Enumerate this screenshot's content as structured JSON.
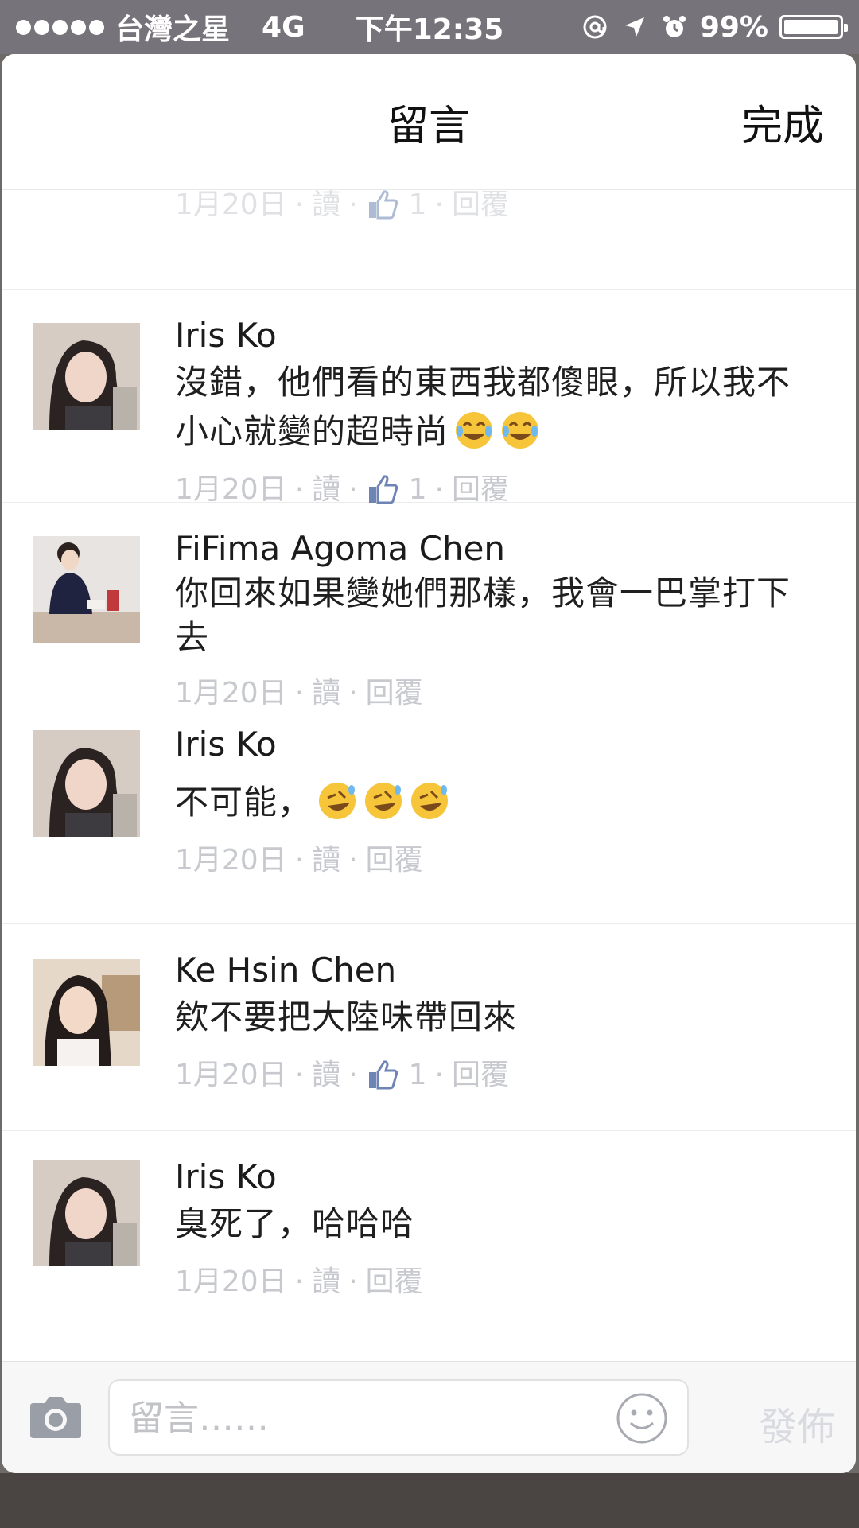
{
  "status_bar": {
    "carrier": "台灣之星",
    "network": "4G",
    "time": "下午12:35",
    "battery_text": "99%",
    "battery_level": 0.99,
    "icons": [
      "at-icon",
      "location-arrow-icon",
      "alarm-icon"
    ]
  },
  "nav": {
    "title": "留言",
    "done": "完成"
  },
  "previous_meta": {
    "date": "1月20日",
    "read": "讀",
    "likes": "1",
    "reply": "回覆"
  },
  "comments": [
    {
      "name": "Iris Ko",
      "text": "沒錯，他們看的東西我都傻眼，所以我不小心就變的超時尚",
      "emoji": [
        "joy-icon",
        "joy-icon"
      ],
      "date": "1月20日",
      "read": "讀",
      "likes": "1",
      "reply": "回覆"
    },
    {
      "name": "FiFima Agoma Chen",
      "text": "你回來如果變她們那樣，我會一巴掌打下去",
      "emoji": [],
      "date": "1月20日",
      "read": "讀",
      "likes": "",
      "reply": "回覆"
    },
    {
      "name": "Iris Ko",
      "text": "不可能，",
      "emoji": [
        "rofl-icon",
        "rofl-icon",
        "rofl-icon"
      ],
      "date": "1月20日",
      "read": "讀",
      "likes": "",
      "reply": "回覆"
    },
    {
      "name": "Ke Hsin Chen",
      "text": "欸不要把大陸味帶回來",
      "emoji": [],
      "date": "1月20日",
      "read": "讀",
      "likes": "1",
      "reply": "回覆"
    },
    {
      "name": "Iris Ko",
      "text": "臭死了，哈哈哈",
      "emoji": [],
      "date": "1月20日",
      "read": "讀",
      "likes": "",
      "reply": "回覆"
    }
  ],
  "composer": {
    "placeholder": "留言……",
    "post": "發佈",
    "value": ""
  },
  "colors": {
    "meta_text": "#c7c9cf",
    "like_blue": "#6d84b4",
    "emoji_yellow": "#f6c53a"
  }
}
